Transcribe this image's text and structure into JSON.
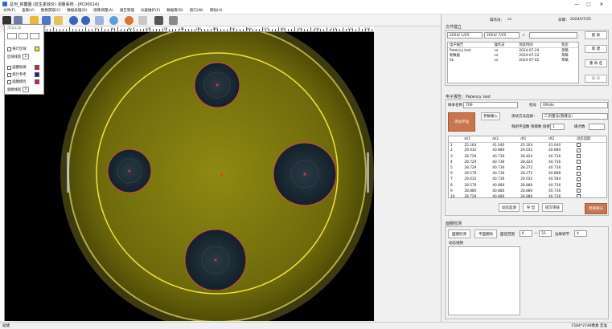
{
  "window": {
    "title": "总剂_抑菌圈  (抗生素效价)  测量系统 - [PC00014]",
    "minimize": "—",
    "maximize": "▢",
    "close": "✕"
  },
  "menu": [
    "文件(F)",
    "查看(V)",
    "图像获取(C)",
    "数据处理(D)",
    "图像测量(A)",
    "报告管理",
    "仪器维护(E)",
    "数据库(D)",
    "窗口(W)",
    "帮助(H)"
  ],
  "ruler": {
    "labels": [
      "70",
      "80",
      "90",
      "100",
      "110",
      "120",
      "130",
      "140",
      "150",
      "160",
      "170",
      "180",
      "190",
      "200",
      "210",
      "220",
      "230"
    ]
  },
  "float_panel": {
    "title": "浮动工具",
    "chk1": "统计区域",
    "chk2": "区域线宽",
    "width1": "1",
    "chk3": "面圈轮廓",
    "chk4": "统计参考",
    "chk5": "面圈模亮",
    "chk6": "面圈线宽",
    "width2": "1",
    "colors": {
      "yellow": "#f6e71e",
      "red": "#e0202a",
      "blue": "#1d1da8",
      "magenta": "#d4167a"
    }
  },
  "header": {
    "operator_label": "操作员：",
    "operator": "cz",
    "date_label": "日期：",
    "date": "2024/07/25"
  },
  "file_group": {
    "title": "文件建立",
    "date_from": "2024/ 1/25",
    "date_to": "2024/ 7/25",
    "search_value": "",
    "columns": [
      "电子报告",
      "操作员",
      "测试时间",
      "状态"
    ],
    "rows": [
      [
        "Patency test",
        "cz",
        "2024-07-24",
        "草稿"
      ],
      [
        "新数据",
        "cz",
        "2024-07-22",
        "草稿"
      ],
      [
        "5k",
        "cz",
        "2024-07-02",
        "草稿"
      ]
    ],
    "btn_query": "搜 索",
    "btn_new": "新 建",
    "btn_rename": "重 命 名",
    "btn_delete": "删 除"
  },
  "report_group": {
    "title": "电子报告：Patency test",
    "sample_name_label": "样本名称",
    "sample_name": "709",
    "batch_label": "批号",
    "batch": "09hdv",
    "add_plate": "添加平皿",
    "param_input": "参数输入",
    "method_label": "测试方法选择：",
    "method": "二剂量法(管碟法)",
    "plates_label": "每组平皿数",
    "plates": "1",
    "order_label": "管碟数 值者走",
    "order": "",
    "cylinders_label": "碟点数",
    "columns": [
      "",
      "ds1",
      "ds2",
      "dt1",
      "dt2",
      "动态追踪"
    ],
    "rows": [
      [
        "1",
        "25.164",
        "41.040",
        "25.164",
        "41.040"
      ],
      [
        "2",
        "29.032",
        "40.880",
        "29.032",
        "40.880"
      ],
      [
        "3",
        "28.729",
        "40.736",
        "28.424",
        "40.736"
      ],
      [
        "4",
        "28.729",
        "40.736",
        "28.424",
        "40.736"
      ],
      [
        "5",
        "28.729",
        "40.736",
        "28.272",
        "40.736"
      ],
      [
        "6",
        "28.576",
        "40.736",
        "28.272",
        "40.888"
      ],
      [
        "7",
        "29.032",
        "40.736",
        "29.032",
        "40.584"
      ],
      [
        "8",
        "28.576",
        "40.880",
        "28.880",
        "40.736"
      ],
      [
        "9",
        "28.880",
        "40.880",
        "28.880",
        "40.736"
      ],
      [
        "10",
        "28.729",
        "40.880",
        "28.880",
        "40.736"
      ]
    ],
    "btn_dynamic": "动态监测",
    "btn_export": "导 出",
    "btn_submit": "提交审核",
    "btn_confirm": "结果确认"
  },
  "measure_group": {
    "title": "面圈检测",
    "btn_detect": "面圈检测",
    "btn_plate_detect": "平面圈除",
    "range_label": "面径范围",
    "range_from": "6",
    "range_to": "31",
    "threshold_label": "边缘调节",
    "threshold": "4",
    "monitor_label": "动态视频"
  },
  "status": {
    "left": "就绪",
    "right": "1584*2748像素 定准"
  }
}
